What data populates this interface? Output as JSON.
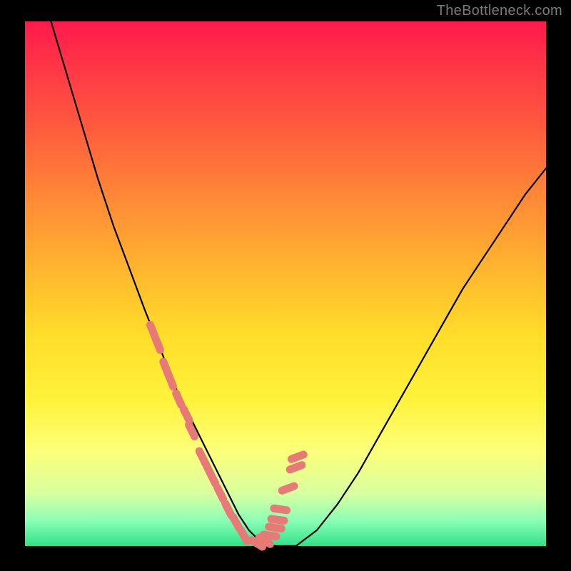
{
  "watermark": "TheBottleneck.com",
  "colors": {
    "curve": "#000000",
    "marker": "#e77a77",
    "background_top": "#ff1a4b",
    "background_bottom": "#2fe28c",
    "frame": "#000000"
  },
  "chart_data": {
    "type": "line",
    "title": "",
    "xlabel": "",
    "ylabel": "",
    "xlim": [
      0,
      100
    ],
    "ylim": [
      0,
      100
    ],
    "grid": false,
    "legend": false,
    "series": [
      {
        "name": "bottleneck-curve",
        "x": [
          5,
          8,
          11,
          14,
          17,
          20,
          23,
          25,
          27,
          29,
          31,
          33,
          35,
          37,
          39,
          41,
          43,
          45,
          48,
          52,
          56,
          60,
          64,
          68,
          72,
          76,
          80,
          84,
          88,
          92,
          96,
          100
        ],
        "y": [
          100,
          90,
          80,
          70,
          61,
          53,
          45,
          40,
          35,
          30,
          26,
          22,
          18,
          14,
          10,
          6,
          3,
          1,
          0,
          0,
          3,
          8,
          14,
          21,
          28,
          35,
          42,
          49,
          55,
          61,
          67,
          72
        ]
      }
    ],
    "markers": {
      "name": "highlight-points",
      "x": [
        24.5,
        25.5,
        27,
        28,
        29.5,
        31,
        32,
        34,
        35,
        36,
        37.5,
        39,
        40.5,
        42,
        44.5,
        46,
        47,
        48,
        48.5,
        49,
        50.5,
        52,
        52.3
      ],
      "y": [
        41,
        38.5,
        34,
        31.5,
        28,
        25,
        22,
        17,
        15,
        13,
        10,
        7,
        4.5,
        2,
        0.5,
        1,
        2,
        3.5,
        5,
        7,
        11,
        15,
        17
      ]
    }
  }
}
